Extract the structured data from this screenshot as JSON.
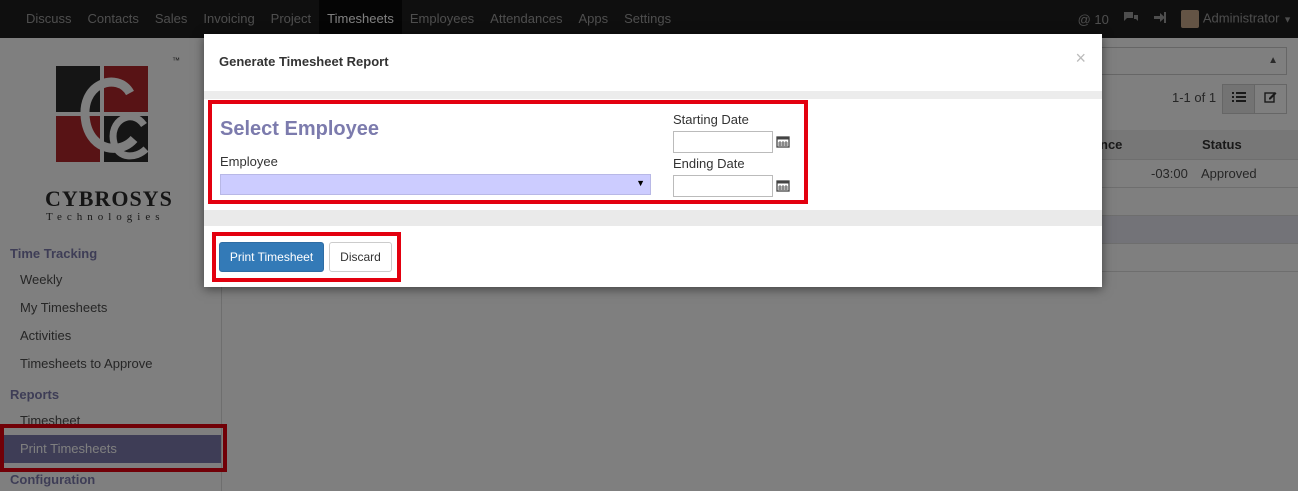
{
  "topbar": {
    "menu": [
      "Discuss",
      "Contacts",
      "Sales",
      "Invoicing",
      "Project",
      "Timesheets",
      "Employees",
      "Attendances",
      "Apps",
      "Settings"
    ],
    "active_menu": "Timesheets",
    "messages_count": "@ 10",
    "user_name": "Administrator"
  },
  "sidebar": {
    "logo_name": "CYBROSYS",
    "logo_sub": "Technologies",
    "logo_tm": "™",
    "sections": [
      {
        "title": "Time Tracking",
        "items": [
          "Weekly",
          "My Timesheets",
          "Activities",
          "Timesheets to Approve"
        ]
      },
      {
        "title": "Reports",
        "items": [
          "Timesheet",
          "Print Timesheets"
        ]
      },
      {
        "title": "Configuration",
        "items": []
      }
    ],
    "active_item": "Print Timesheets"
  },
  "content": {
    "pager": "1-1 of 1",
    "columns": [
      "nce",
      "Status"
    ],
    "row": {
      "difference": "-03:00",
      "status": "Approved"
    }
  },
  "modal": {
    "title": "Generate Timesheet Report",
    "close": "×",
    "heading": "Select Employee",
    "employee_label": "Employee",
    "employee_value": "",
    "starting_date_label": "Starting Date",
    "ending_date_label": "Ending Date",
    "starting_date_value": "",
    "ending_date_value": "",
    "print_button": "Print Timesheet",
    "discard_button": "Discard"
  },
  "colors": {
    "accent": "#7c7bad",
    "primary": "#337ab7",
    "highlight": "#e3000f",
    "select_bg": "#ccccff"
  }
}
